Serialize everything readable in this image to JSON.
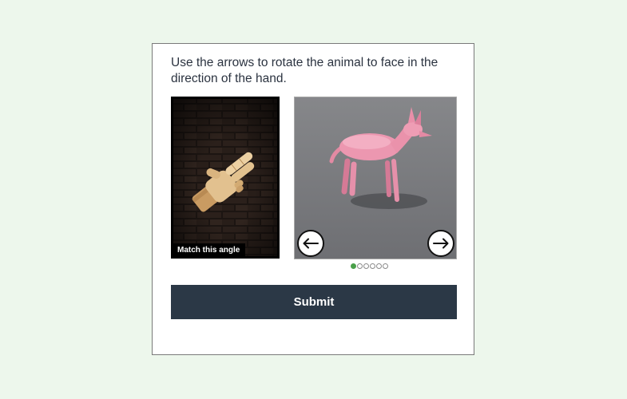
{
  "instructions": "Use the arrows to rotate the animal to face in the direction of the hand.",
  "reference_panel": {
    "label": "Match this angle",
    "icon": "pointing-hand-image"
  },
  "animal_panel": {
    "icon": "dog-3d-model-image",
    "left_arrow_icon": "arrow-left-icon",
    "right_arrow_icon": "arrow-right-icon"
  },
  "pagination": {
    "total": 6,
    "current": 1
  },
  "submit_label": "Submit",
  "colors": {
    "page_bg": "#edf7ec",
    "button_bg": "#2b3846",
    "active_dot": "#4aa04a"
  }
}
